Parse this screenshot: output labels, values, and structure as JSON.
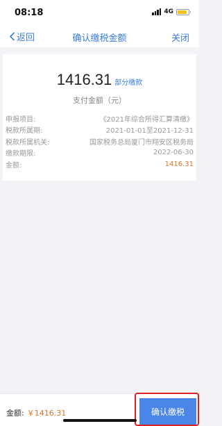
{
  "status_bar": {
    "time": "08:18",
    "network": "4G"
  },
  "nav": {
    "back_label": "返回",
    "title": "确认缴税金额",
    "close_label": "关闭"
  },
  "summary": {
    "amount": "1416.31",
    "partial_label": "部分缴款",
    "amount_caption": "支付金额（元）"
  },
  "details": {
    "rows": [
      {
        "label": "申报项目:",
        "value": "《2021年综合所得汇算清缴》"
      },
      {
        "label": "税款所属期:",
        "value": "2021-01-01至2021-12-31"
      },
      {
        "label": "税款所属机关:",
        "value": "国家税务总局厦门市翔安区税务局"
      },
      {
        "label": "缴款期限:",
        "value": "2022-06-30"
      },
      {
        "label": "金额:",
        "value": "1416.31"
      }
    ]
  },
  "bottom": {
    "amount_label": "金额:",
    "amount_value": "￥1416.31",
    "confirm_label": "确认缴税"
  },
  "colors": {
    "accent_blue": "#3b7ddc",
    "button_blue": "#4a86e8",
    "amount_orange": "#e0732a",
    "highlight_red": "#e02020"
  }
}
